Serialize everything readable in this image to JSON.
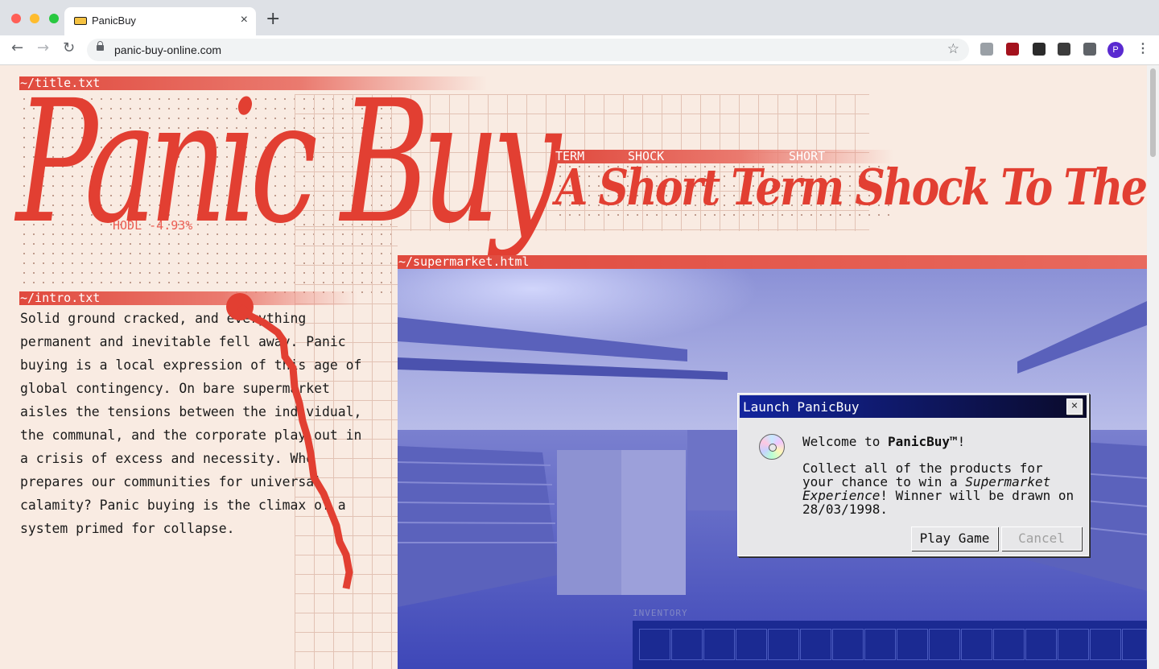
{
  "browser": {
    "tab_title": "PanicBuy",
    "tab_close": "×",
    "new_tab": "+",
    "url": "panic-buy-online.com",
    "back_icon": "←",
    "forward_icon": "→",
    "reload_icon": "↻",
    "star_icon": "☆",
    "profile_initial": "P",
    "menu_icon": "⋮",
    "extensions": [
      "tab-grid-icon",
      "ublock-icon",
      "bird-icon",
      "search-ext-icon",
      "puzzle-icon"
    ]
  },
  "colors": {
    "accent": "#e23f32",
    "page_bg": "#f9ebe2",
    "scene": "#6a70c2",
    "dialog_bar": "#13259e"
  },
  "labels": {
    "title_window": "~/title.txt",
    "intro_window": "~/intro.txt",
    "supermarket_window": "~/supermarket.html"
  },
  "title": "Panic Buy",
  "ticker_overlay": "HODL -4.93%",
  "tickers": [
    "TERM",
    "SHOCK",
    "SHORT"
  ],
  "subtitle": "A Short Term Shock To The System",
  "intro": "Solid ground cracked, and everything permanent and inevitable fell away. Panic buying is a local expression of this age of global contingency. On bare supermarket aisles the tensions between the individual, the communal, and the corporate play out in a crisis of excess and necessity. Who prepares our communities for universal calamity? Panic buying is the climax of a system primed for collapse.",
  "dialog": {
    "title": "Launch PanicBuy",
    "close": "×",
    "welcome_prefix": "Welcome to ",
    "welcome_brand": "PanicBuy™",
    "welcome_suffix": "!",
    "body_1": "Collect all of the products for your chance to win a ",
    "body_em": "Supermarket Experience",
    "body_2": "! Winner will be drawn on 28/03/1998.",
    "play_button": "Play Game",
    "cancel_button": "Cancel"
  },
  "inventory": {
    "label": "INVENTORY",
    "slots": 16
  }
}
